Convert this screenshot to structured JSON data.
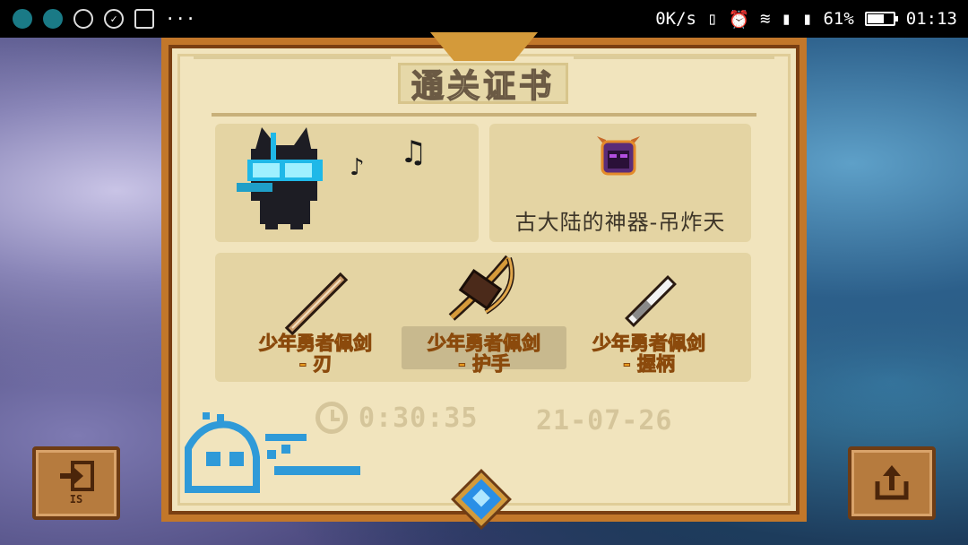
{
  "status_bar": {
    "net_speed": "0K/s",
    "battery_pct": "61%",
    "battery_level": 0.61,
    "time": "01:13",
    "icons": [
      "app-icon-1",
      "app-icon-2",
      "location-icon",
      "check-circle-icon",
      "image-icon",
      "more-dots-icon",
      "vibrate-icon",
      "alarm-icon",
      "wifi-icon",
      "sim1-icon",
      "sim2-icon",
      "battery-icon"
    ]
  },
  "certificate": {
    "title": "通关证书",
    "artifact": {
      "name": "古大陆的神器-吊炸天",
      "icon": "demon-helmet-icon"
    },
    "weapons": [
      {
        "label_line1": "少年勇者佩剑",
        "label_line2": "- 刃",
        "icon": "sword-blade-icon"
      },
      {
        "label_line1": "少年勇者佩剑",
        "label_line2": "- 护手",
        "icon": "crossbow-guard-icon"
      },
      {
        "label_line1": "少年勇者佩剑",
        "label_line2": "- 握柄",
        "icon": "sword-hilt-icon"
      }
    ],
    "time": "0:30:35",
    "date": "21-07-26"
  },
  "buttons": {
    "exit_label": "IS",
    "exit_icon": "exit-door-icon",
    "share_icon": "share-icon"
  },
  "colors": {
    "panel_bg": "#f1e4bd",
    "frame": "#c2772a",
    "label_orange": "#e89a20",
    "accent_blue": "#2a8fe6"
  }
}
